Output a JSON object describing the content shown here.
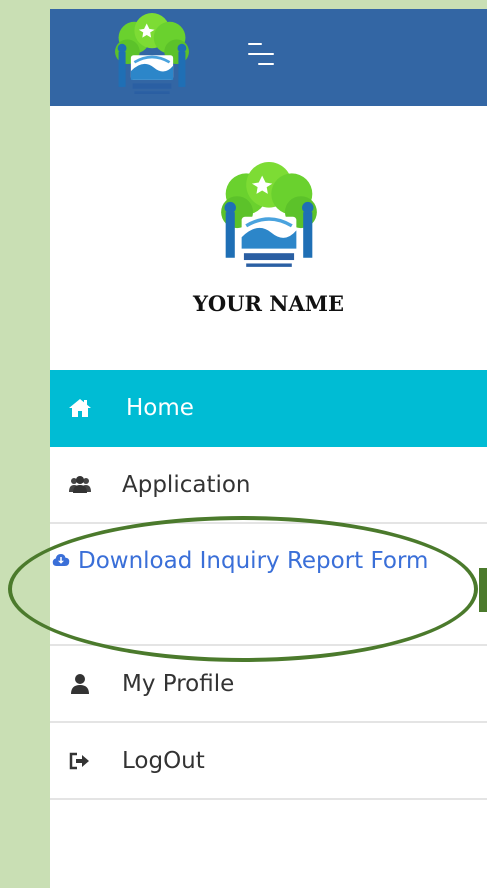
{
  "profile": {
    "name": "YOUR NAME"
  },
  "nav": {
    "home": "Home",
    "application": "Application",
    "download": "Download Inquiry Report Form",
    "profile": "My Profile",
    "logout": "LogOut"
  },
  "colors": {
    "topbar": "#3366a4",
    "active": "#00bcd4",
    "link": "#3a6fd8",
    "highlight": "#4b7a2c",
    "page_bg": "#c9dfb4"
  },
  "icons": [
    "logo",
    "menu-icon",
    "home-icon",
    "users-icon",
    "cloud-download-icon",
    "user-icon",
    "sign-out-icon"
  ]
}
